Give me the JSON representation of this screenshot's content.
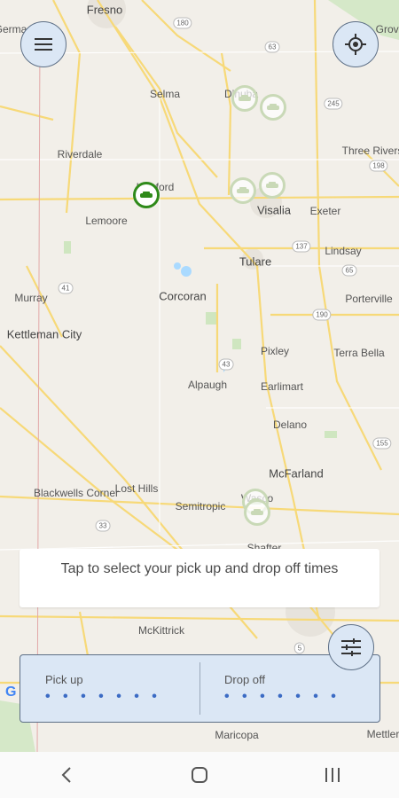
{
  "map": {
    "places": [
      {
        "name": "Fresno"
      },
      {
        "name": "Selma"
      },
      {
        "name": "Dinuba"
      },
      {
        "name": "Riverdale"
      },
      {
        "name": "Hanford"
      },
      {
        "name": "Lemoore"
      },
      {
        "name": "Visalia"
      },
      {
        "name": "Exeter"
      },
      {
        "name": "Three Rivers"
      },
      {
        "name": "Tulare"
      },
      {
        "name": "Lindsay"
      },
      {
        "name": "Murray"
      },
      {
        "name": "Corcoran"
      },
      {
        "name": "Porterville"
      },
      {
        "name": "Kettleman City"
      },
      {
        "name": "Pixley"
      },
      {
        "name": "Terra Bella"
      },
      {
        "name": "Alpaugh"
      },
      {
        "name": "Earlimart"
      },
      {
        "name": "Delano"
      },
      {
        "name": "McFarland"
      },
      {
        "name": "Blackwells Corner"
      },
      {
        "name": "Lost Hills"
      },
      {
        "name": "Semitropic"
      },
      {
        "name": "Wasco"
      },
      {
        "name": "Shafter"
      },
      {
        "name": "McKittrick"
      },
      {
        "name": "Maricopa"
      },
      {
        "name": "Mettler"
      },
      {
        "name": "Grove"
      },
      {
        "name": "Germa"
      }
    ],
    "routes": [
      "180",
      "63",
      "245",
      "198",
      "41",
      "137",
      "65",
      "190",
      "43",
      "155",
      "33",
      "5"
    ]
  },
  "banner": {
    "text": "Tap to select your pick up and drop off times"
  },
  "pickup": {
    "label": "Pick up",
    "value": "• • • • • • •"
  },
  "dropoff": {
    "label": "Drop off",
    "value": "• • • • • • •"
  },
  "colors": {
    "accent": "#3b6bc4",
    "panel": "#dbe7f5",
    "marker": "#2f8a1a"
  },
  "icons": {
    "menu": "menu-icon",
    "locate": "my-location-icon",
    "filter": "tune-icon",
    "back": "back-icon",
    "home": "home-icon",
    "recents": "recents-icon"
  }
}
